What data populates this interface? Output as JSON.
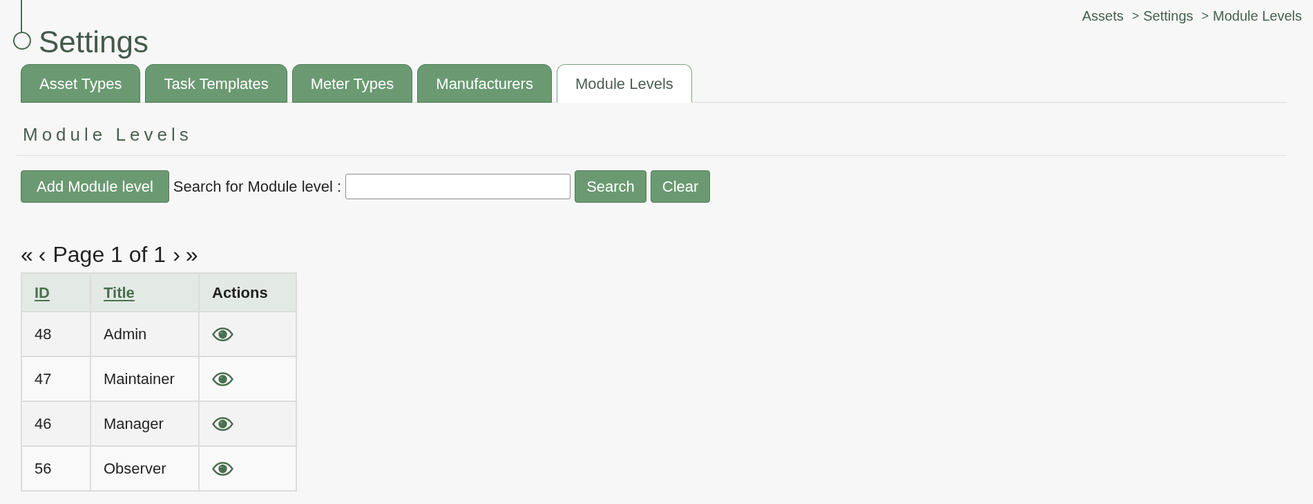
{
  "header": {
    "title": "Settings"
  },
  "breadcrumb": {
    "items": [
      {
        "label": "Assets"
      },
      {
        "separator": ">",
        "label": "Settings"
      },
      {
        "separator": ">",
        "label": "Module Levels"
      }
    ]
  },
  "tabs": [
    {
      "label": "Asset Types",
      "selected": false
    },
    {
      "label": "Task Templates",
      "selected": false
    },
    {
      "label": "Meter Types",
      "selected": false
    },
    {
      "label": "Manufacturers",
      "selected": false
    },
    {
      "label": "Module Levels",
      "selected": true
    }
  ],
  "section": {
    "title": "Module Levels"
  },
  "toolbar": {
    "add_button": "Add Module level",
    "search_label": "Search for Module level :",
    "search_button": "Search",
    "clear_button": "Clear"
  },
  "pagination": {
    "first": "«",
    "prev": "‹",
    "label": "Page 1 of 1",
    "next": "›",
    "last": "»"
  },
  "table": {
    "columns": [
      {
        "label": "ID",
        "sortable": true
      },
      {
        "label": "Title",
        "sortable": true
      },
      {
        "label": "Actions",
        "sortable": false
      }
    ],
    "rows": [
      {
        "id": "48",
        "title": "Admin"
      },
      {
        "id": "47",
        "title": "Maintainer"
      },
      {
        "id": "46",
        "title": "Manager"
      },
      {
        "id": "56",
        "title": "Observer"
      }
    ]
  }
}
